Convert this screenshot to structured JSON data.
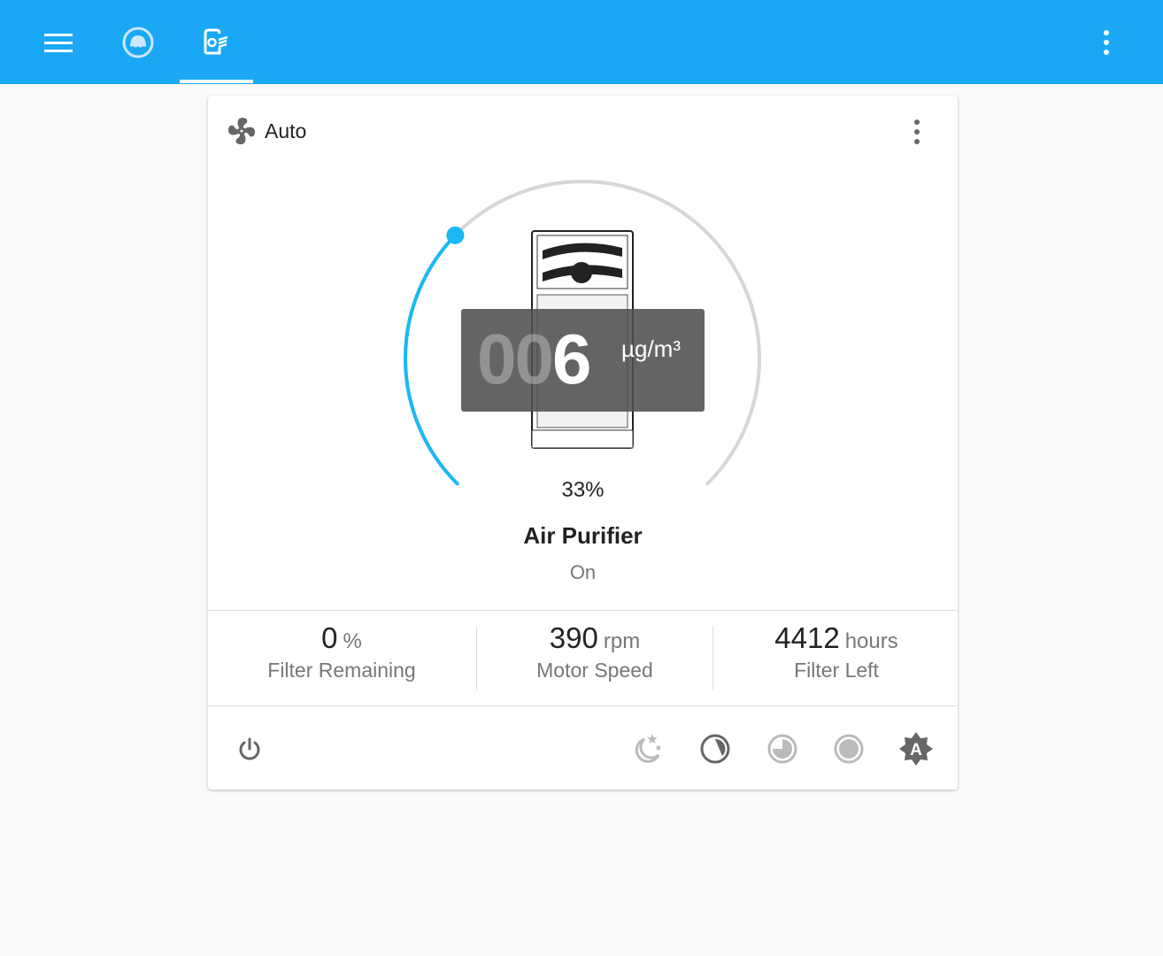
{
  "topbar": {
    "icons": [
      "menu-icon",
      "robot-vacuum-icon",
      "air-purifier-icon",
      "more-vert-icon"
    ],
    "accent": "#1aa8f5"
  },
  "card": {
    "mode": "Auto",
    "gauge": {
      "value_percent": 33,
      "percent_label": "33%",
      "color": "#1ab8f5"
    },
    "display": {
      "dim_digits": "00",
      "digits": "6",
      "unit": "µg/m³"
    },
    "name": "Air Purifier",
    "state": "On",
    "stats": [
      {
        "value": "0",
        "unit": "%",
        "label": "Filter Remaining"
      },
      {
        "value": "390",
        "unit": "rpm",
        "label": "Motor Speed"
      },
      {
        "value": "4412",
        "unit": "hours",
        "label": "Filter Left"
      }
    ],
    "buttons": [
      "power",
      "silent",
      "low",
      "medium",
      "high",
      "auto"
    ]
  }
}
